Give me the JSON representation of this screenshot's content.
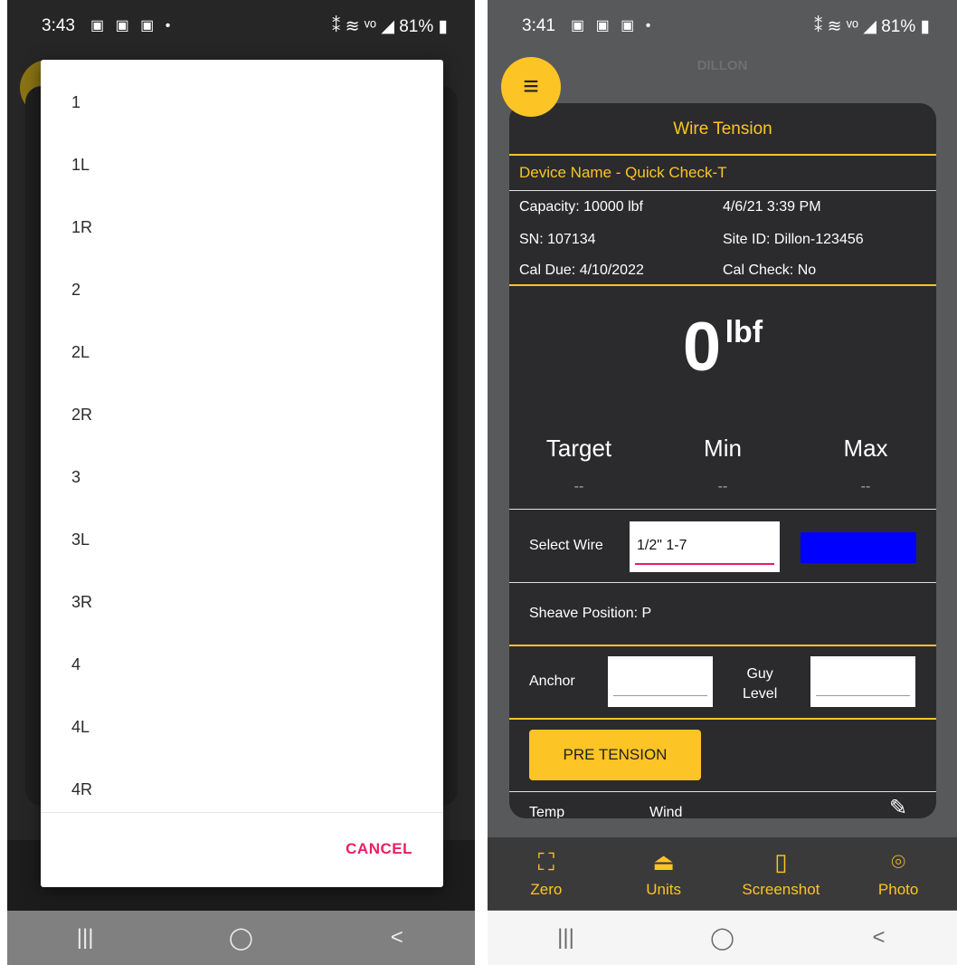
{
  "left": {
    "status": {
      "time": "3:43",
      "icons": "▣ ▣ ▣ •",
      "right": "⁑ ≋ ᵛᵒ ◢ 81% ▮"
    },
    "dialog": {
      "options": [
        "1",
        "1L",
        "1R",
        "2",
        "2L",
        "2R",
        "3",
        "3L",
        "3R",
        "4",
        "4L",
        "4R"
      ],
      "cancel": "CANCEL"
    },
    "nav": {
      "recents": "|||",
      "home": "◯",
      "back": "<"
    }
  },
  "right": {
    "status": {
      "time": "3:41",
      "icons": "▣ ▣ ▣ •",
      "right": "⁑ ≋ ᵛᵒ ◢ 81% ▮"
    },
    "brand": "DILLON",
    "menu_icon": "≡",
    "card": {
      "title": "Wire Tension",
      "device": "Device Name  -  Quick Check-T",
      "capacity": "Capacity: 10000 lbf",
      "datetime": "4/6/21 3:39 PM",
      "sn": "SN: 107134",
      "site_id": "Site ID: Dillon-123456",
      "cal_due": "Cal Due:  4/10/2022",
      "cal_check": "Cal Check: No",
      "reading": "0",
      "reading_unit": "lbf",
      "target_label": "Target",
      "target_value": "--",
      "min_label": "Min",
      "min_value": "--",
      "max_label": "Max",
      "max_value": "--",
      "select_wire_label": "Select Wire",
      "select_wire_value": "1/2\" 1-7",
      "wire_color": "#0000ff",
      "sheave": "Sheave Position:  P",
      "anchor_label": "Anchor",
      "guy_label_1": "Guy",
      "guy_label_2": "Level",
      "pre_tension": "PRE TENSION",
      "temp_label": "Temp",
      "wind_label": "Wind",
      "edit_icon": "✎"
    },
    "tabs": [
      {
        "icon": "⛶",
        "label": "Zero"
      },
      {
        "icon": "⏏",
        "label": "Units"
      },
      {
        "icon": "▯",
        "label": "Screenshot"
      },
      {
        "icon": "⌾",
        "label": "Photo"
      }
    ],
    "nav": {
      "recents": "|||",
      "home": "◯",
      "back": "<"
    }
  },
  "colors": {
    "accent": "#fcc425",
    "link_pink": "#e91e63",
    "wire_blue": "#0000ff"
  }
}
